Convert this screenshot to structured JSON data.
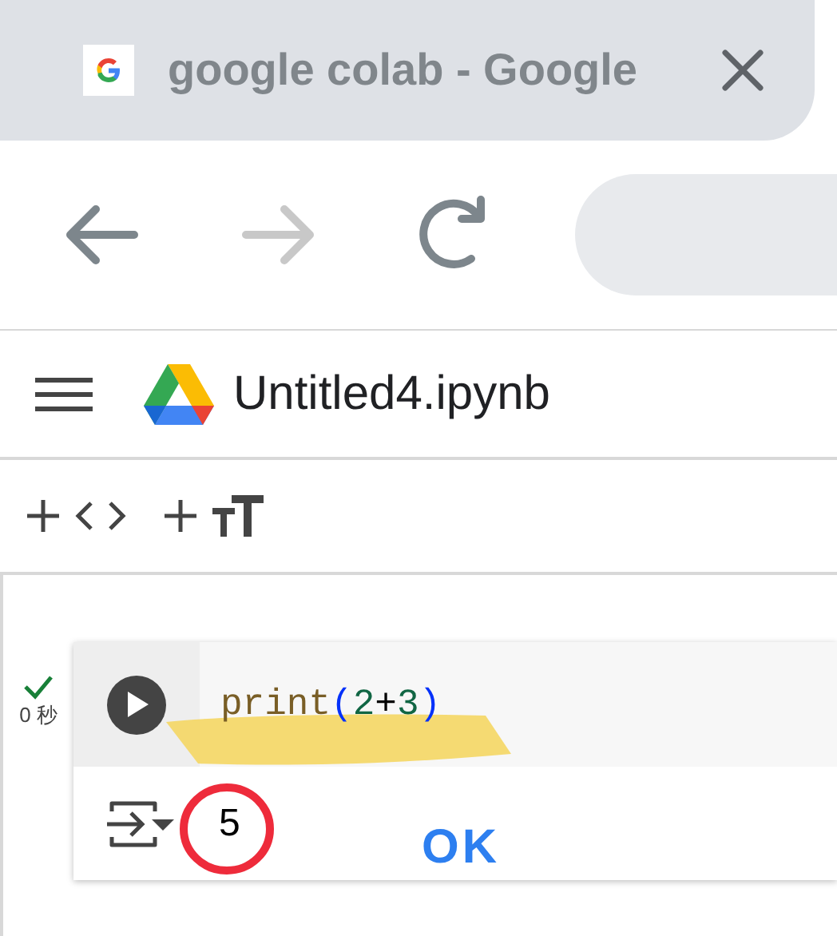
{
  "browser_tab": {
    "title": "google colab - Google"
  },
  "notebook": {
    "title": "Untitled4.ipynb"
  },
  "cell": {
    "status": {
      "done": true,
      "time": "0 秒"
    },
    "code": [
      {
        "kind": "function",
        "text": "print"
      },
      {
        "kind": "bracket",
        "text": "("
      },
      {
        "kind": "number",
        "text": "2"
      },
      {
        "kind": "operator",
        "text": "+"
      },
      {
        "kind": "number",
        "text": "3"
      },
      {
        "kind": "bracket",
        "text": ")"
      }
    ],
    "output": "5"
  },
  "annotation": {
    "text": "OK"
  }
}
